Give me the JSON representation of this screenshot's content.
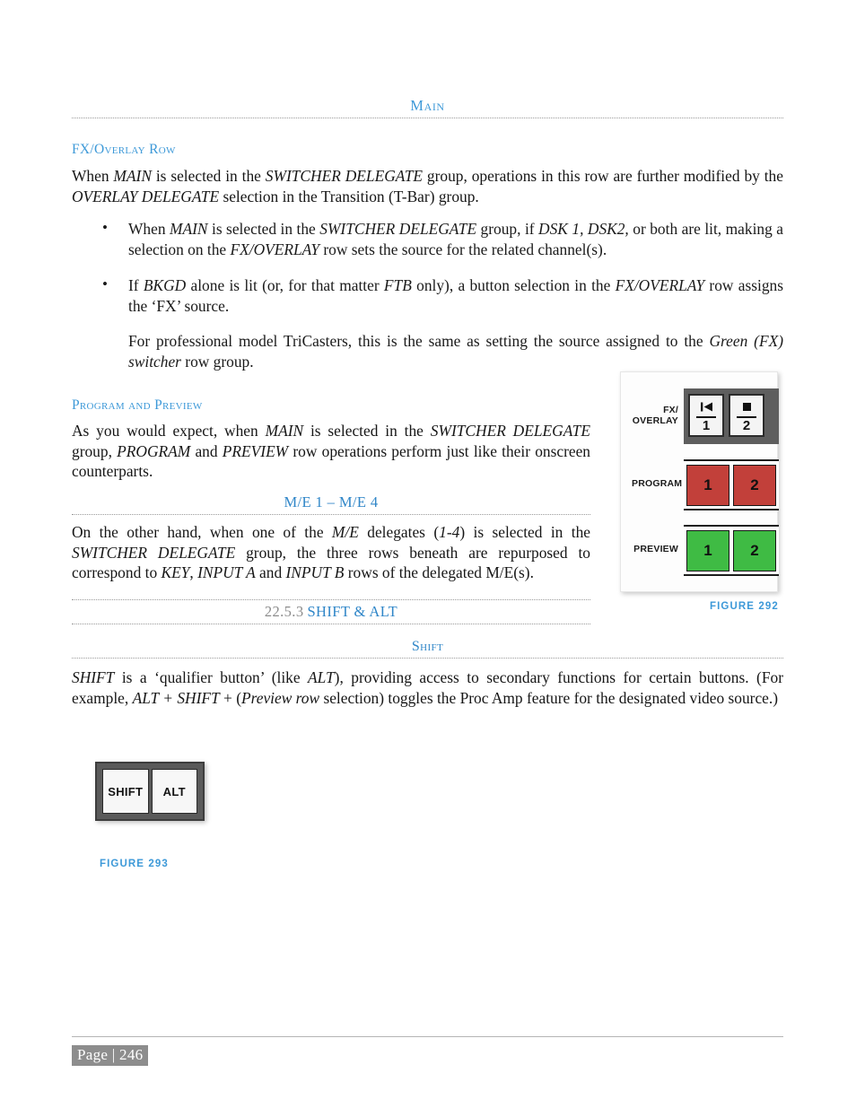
{
  "header": {
    "running_title": "Main"
  },
  "sections": {
    "fx_overlay_row": {
      "heading": "FX/Overlay Row",
      "intro_html": "When <em>MAIN</em> is selected in the <em>SWITCHER DELEGATE</em> group, operations in this row are further modified by the <em>OVERLAY DELEGATE</em> selection in the Transition (T-Bar) group.",
      "bullets": [
        {
          "marker": "•",
          "text_html": "When <em>MAIN</em> is selected in the <em>SWITCHER DELEGATE</em> group, if <em>DSK 1, DSK2,</em> or both are lit, making a selection on the <em>FX/OVERLAY</em> row sets the source for the related channel(s)."
        },
        {
          "marker": "•",
          "text_html": "If <em>BKGD</em> alone is lit (or, for that matter <em>FTB</em> only), a button selection in the <em>FX/OVERLAY</em> row assigns the ‘FX’ source.",
          "sub_text_html": "For professional model TriCasters, this is the same as setting the source assigned to the <em>Green (FX) switcher</em> row group."
        }
      ]
    },
    "program_and_preview": {
      "heading": "Program and Preview",
      "body_html": "As you would expect, when <em>MAIN</em> is selected in the <em>SWITCHER DELEGATE</em> group, <em>PROGRAM</em> and <em>PREVIEW</em> row operations perform just like their onscreen counterparts."
    },
    "me_1_me_4": {
      "heading": "M/E 1 – M/E 4",
      "body_html": "On the other hand, when one of the <em>M/E</em> delegates (<em>1-4</em>) is selected in the <em>SWITCHER DELEGATE</em> group, the three rows beneath are repurposed to correspond to <em>KEY</em>, <em>INPUT A</em> and <em>INPUT B</em> rows of the delegated M/E(s)."
    },
    "shift_and_alt": {
      "number": "22.5.3",
      "heading": "SHIFT & ALT",
      "sub_heading": "Shift",
      "body_html": "<em>SHIFT</em> is a ‘qualifier button’ (like <em>ALT</em>), providing access to secondary functions for certain buttons.  (For example, <em>ALT + SHIFT</em> + (<em>Preview row</em> selection) toggles the Proc Amp feature for the designated video source.)"
    }
  },
  "figure_292": {
    "caption": "FIGURE 292",
    "rows": [
      {
        "label_line1": "FX/",
        "label_line2": "OVERLAY",
        "type": "fx",
        "band_color": "#5e5e5e",
        "buttons": [
          {
            "glyph": "skip-back-icon",
            "glyph_char": "▌◀",
            "number": "1"
          },
          {
            "glyph": "stop-square-icon",
            "glyph_char": "■",
            "number": "2"
          }
        ]
      },
      {
        "label_line1": "PROGRAM",
        "label_line2": "",
        "type": "program",
        "button_color": "#c2403a",
        "buttons": [
          {
            "number": "1"
          },
          {
            "number": "2"
          }
        ]
      },
      {
        "label_line1": "PREVIEW",
        "label_line2": "",
        "type": "preview",
        "button_color": "#3fbb44",
        "buttons": [
          {
            "number": "1"
          },
          {
            "number": "2"
          }
        ]
      }
    ]
  },
  "figure_293": {
    "caption": "FIGURE 293",
    "buttons": [
      {
        "label": "SHIFT"
      },
      {
        "label": "ALT"
      }
    ]
  },
  "footer": {
    "page_label": "Page | 246"
  },
  "colors": {
    "accent_blue": "#3d99d8",
    "heading_blue": "#2f86c8",
    "section_number_gray": "#8c8c8c",
    "program_red": "#c2403a",
    "preview_green": "#3fbb44",
    "fx_band_gray": "#5e5e5e",
    "page_num_bg": "#8d8d8d"
  }
}
